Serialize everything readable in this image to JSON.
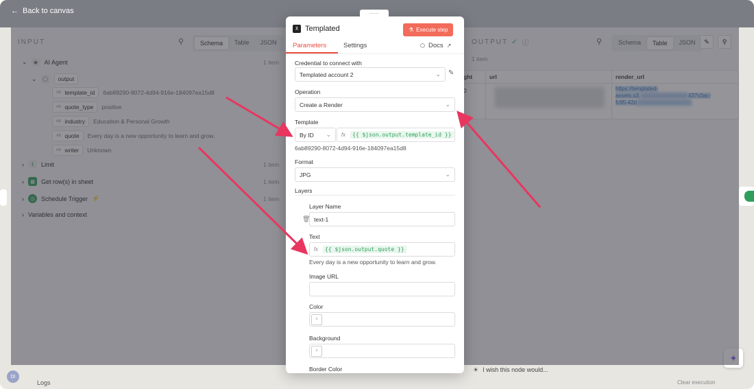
{
  "topbar": {
    "back_label": "Back to canvas"
  },
  "input": {
    "title": "INPUT",
    "tabs": [
      "Schema",
      "Table",
      "JSON"
    ],
    "tree": {
      "ai_agent": {
        "label": "AI Agent",
        "count": "1 item"
      },
      "output_label": "output",
      "fields": [
        {
          "key": "template_id",
          "value": "6ab89290-8072-4d94-916e-184097ea15d8"
        },
        {
          "key": "quote_type",
          "value": "positive"
        },
        {
          "key": "industry",
          "value": "Education & Personal Growth"
        },
        {
          "key": "quote",
          "value": "Every day is a new opportunity to learn and grow."
        },
        {
          "key": "writer",
          "value": "Unknown"
        }
      ],
      "type_badge": "AB",
      "nodes": [
        {
          "label": "Limit",
          "count": "1 item"
        },
        {
          "label": "Get row(s) in sheet",
          "count": "1 item"
        },
        {
          "label": "Schedule Trigger",
          "count": "1 item"
        }
      ],
      "vars": "Variables and context"
    }
  },
  "output": {
    "title": "OUTPUT",
    "count": "1 item",
    "tabs": [
      "Schema",
      "Table",
      "JSON"
    ],
    "columns": [
      "ght",
      "url",
      "render_url"
    ],
    "first_cell": "0",
    "render_url_lines": [
      "https://templated-",
      "assets.s3.",
      "437c0ac-",
      "fc95-42d"
    ]
  },
  "modal": {
    "title": "Templated",
    "execute_label": "Execute step",
    "tabs": [
      "Parameters",
      "Settings"
    ],
    "docs_label": "Docs",
    "credential_label": "Credential to connect with",
    "credential_value": "Templated account 2",
    "operation_label": "Operation",
    "operation_value": "Create a Render",
    "template_label": "Template",
    "template_mode": "By ID",
    "template_expr": "{{ $json.output.template_id }}",
    "template_preview": "6ab89290-8072-4d94-916e-184097ea15d8",
    "format_label": "Format",
    "format_value": "JPG",
    "layers_label": "Layers",
    "layer_name_label": "Layer Name",
    "layer_name_value": "text-1",
    "text_label": "Text",
    "text_expr": "{{ $json.output.quote }}",
    "text_preview": "Every day is a new opportunity to learn and grow.",
    "image_url_label": "Image URL",
    "color_label": "Color",
    "background_label": "Background",
    "border_color_label": "Border Color",
    "fx_label": "fx"
  },
  "footer": {
    "wish": "I wish this node would...",
    "logs": "Logs",
    "clear": "Clear execution",
    "avatar": "DI"
  },
  "colors": {
    "accent": "#ea4b3c",
    "execute": "#f26b5b",
    "arrow": "#e8365f",
    "success": "#2f9e5a"
  }
}
